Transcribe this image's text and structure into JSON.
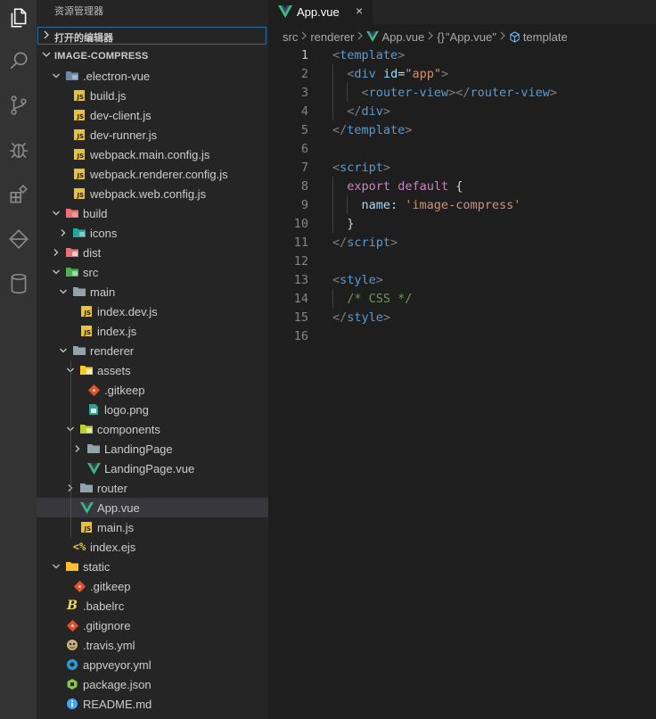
{
  "sidebar": {
    "title": "资源管理器",
    "open_editors": "打开的编辑器",
    "project": "IMAGE-COMPRESS",
    "tree": [
      {
        "name": ".electron-vue",
        "depth": 0,
        "type": "folder",
        "open": true,
        "icon": "folder-electron-icon"
      },
      {
        "name": "build.js",
        "depth": 1,
        "type": "file",
        "icon": "js-icon"
      },
      {
        "name": "dev-client.js",
        "depth": 1,
        "type": "file",
        "icon": "js-icon"
      },
      {
        "name": "dev-runner.js",
        "depth": 1,
        "type": "file",
        "icon": "js-icon"
      },
      {
        "name": "webpack.main.config.js",
        "depth": 1,
        "type": "file",
        "icon": "js-icon"
      },
      {
        "name": "webpack.renderer.config.js",
        "depth": 1,
        "type": "file",
        "icon": "js-icon"
      },
      {
        "name": "webpack.web.config.js",
        "depth": 1,
        "type": "file",
        "icon": "js-icon"
      },
      {
        "name": "build",
        "depth": 0,
        "type": "folder",
        "open": true,
        "icon": "folder-build-icon"
      },
      {
        "name": "icons",
        "depth": 1,
        "type": "folder",
        "open": false,
        "icon": "folder-images-icon"
      },
      {
        "name": "dist",
        "depth": 0,
        "type": "folder",
        "open": false,
        "icon": "folder-dist-icon"
      },
      {
        "name": "src",
        "depth": 0,
        "type": "folder",
        "open": true,
        "icon": "folder-src-icon"
      },
      {
        "name": "main",
        "depth": 1,
        "type": "folder",
        "open": true,
        "icon": "folder-icon"
      },
      {
        "name": "index.dev.js",
        "depth": 2,
        "type": "file",
        "icon": "js-icon"
      },
      {
        "name": "index.js",
        "depth": 2,
        "type": "file",
        "icon": "js-icon"
      },
      {
        "name": "renderer",
        "depth": 1,
        "type": "folder",
        "open": true,
        "icon": "folder-icon"
      },
      {
        "name": "assets",
        "depth": 2,
        "type": "folder",
        "open": true,
        "icon": "folder-assets-icon"
      },
      {
        "name": ".gitkeep",
        "depth": 3,
        "type": "file",
        "icon": "git-icon"
      },
      {
        "name": "logo.png",
        "depth": 3,
        "type": "file",
        "icon": "image-file-icon"
      },
      {
        "name": "components",
        "depth": 2,
        "type": "folder",
        "open": true,
        "icon": "folder-components-icon"
      },
      {
        "name": "LandingPage",
        "depth": 3,
        "type": "folder",
        "open": false,
        "icon": "folder-icon"
      },
      {
        "name": "LandingPage.vue",
        "depth": 3,
        "type": "file",
        "icon": "vue-icon"
      },
      {
        "name": "router",
        "depth": 2,
        "type": "folder",
        "open": false,
        "icon": "folder-icon"
      },
      {
        "name": "App.vue",
        "depth": 2,
        "type": "file",
        "icon": "vue-icon",
        "selected": true
      },
      {
        "name": "main.js",
        "depth": 2,
        "type": "file",
        "icon": "js-icon"
      },
      {
        "name": "index.ejs",
        "depth": 1,
        "type": "file",
        "icon": "ejs-icon"
      },
      {
        "name": "static",
        "depth": 0,
        "type": "folder",
        "open": true,
        "icon": "folder-static-icon"
      },
      {
        "name": ".gitkeep",
        "depth": 1,
        "type": "file",
        "icon": "git-icon"
      },
      {
        "name": ".babelrc",
        "depth": 0,
        "type": "file",
        "icon": "babel-icon"
      },
      {
        "name": ".gitignore",
        "depth": 0,
        "type": "file",
        "icon": "git-icon"
      },
      {
        "name": ".travis.yml",
        "depth": 0,
        "type": "file",
        "icon": "travis-icon"
      },
      {
        "name": "appveyor.yml",
        "depth": 0,
        "type": "file",
        "icon": "appveyor-icon"
      },
      {
        "name": "package.json",
        "depth": 0,
        "type": "file",
        "icon": "npm-icon"
      },
      {
        "name": "README.md",
        "depth": 0,
        "type": "file",
        "icon": "info-icon"
      }
    ]
  },
  "editor": {
    "tab": {
      "label": "App.vue",
      "close": "×"
    },
    "breadcrumb": [
      "src",
      "renderer",
      "App.vue",
      "\"App.vue\"",
      "template"
    ],
    "breadcrumb_prefix": "{}",
    "active_line": 1,
    "lines": [
      [
        [
          "c-punct",
          "<"
        ],
        [
          "c-tag",
          "template"
        ],
        [
          "c-punct",
          ">"
        ]
      ],
      [
        [
          "c-plain",
          "  "
        ],
        [
          "c-punct",
          "<"
        ],
        [
          "c-tag",
          "div"
        ],
        [
          "c-plain",
          " "
        ],
        [
          "c-attr",
          "id"
        ],
        [
          "c-plain",
          "="
        ],
        [
          "c-str",
          "\"app\""
        ],
        [
          "c-punct",
          ">"
        ]
      ],
      [
        [
          "c-plain",
          "    "
        ],
        [
          "c-punct",
          "<"
        ],
        [
          "c-tag",
          "router-view"
        ],
        [
          "c-punct",
          "></"
        ],
        [
          "c-tag",
          "router-view"
        ],
        [
          "c-punct",
          ">"
        ]
      ],
      [
        [
          "c-plain",
          "  "
        ],
        [
          "c-punct",
          "</"
        ],
        [
          "c-tag",
          "div"
        ],
        [
          "c-punct",
          ">"
        ]
      ],
      [
        [
          "c-punct",
          "</"
        ],
        [
          "c-tag",
          "template"
        ],
        [
          "c-punct",
          ">"
        ]
      ],
      [],
      [
        [
          "c-punct",
          "<"
        ],
        [
          "c-tag",
          "script"
        ],
        [
          "c-punct",
          ">"
        ]
      ],
      [
        [
          "c-plain",
          "  "
        ],
        [
          "c-kw",
          "export"
        ],
        [
          "c-plain",
          " "
        ],
        [
          "c-kw",
          "default"
        ],
        [
          "c-plain",
          " {"
        ]
      ],
      [
        [
          "c-plain",
          "    "
        ],
        [
          "c-prop",
          "name"
        ],
        [
          "c-plain",
          ": "
        ],
        [
          "c-str",
          "'image-compress'"
        ]
      ],
      [
        [
          "c-plain",
          "  }"
        ]
      ],
      [
        [
          "c-punct",
          "</"
        ],
        [
          "c-tag",
          "script"
        ],
        [
          "c-punct",
          ">"
        ]
      ],
      [],
      [
        [
          "c-punct",
          "<"
        ],
        [
          "c-tag",
          "style"
        ],
        [
          "c-punct",
          ">"
        ]
      ],
      [
        [
          "c-plain",
          "  "
        ],
        [
          "c-cmt",
          "/* CSS */"
        ]
      ],
      [
        [
          "c-punct",
          "</"
        ],
        [
          "c-tag",
          "style"
        ],
        [
          "c-punct",
          ">"
        ]
      ],
      []
    ]
  },
  "activity_bar": [
    "files-icon",
    "search-icon",
    "source-control-icon",
    "debug-icon",
    "extensions-icon",
    "remote-icon",
    "database-icon"
  ],
  "colors": {
    "accent": "#569cd6",
    "selection": "#37373d",
    "js": "#e8c33a",
    "vue": "#41b883"
  }
}
